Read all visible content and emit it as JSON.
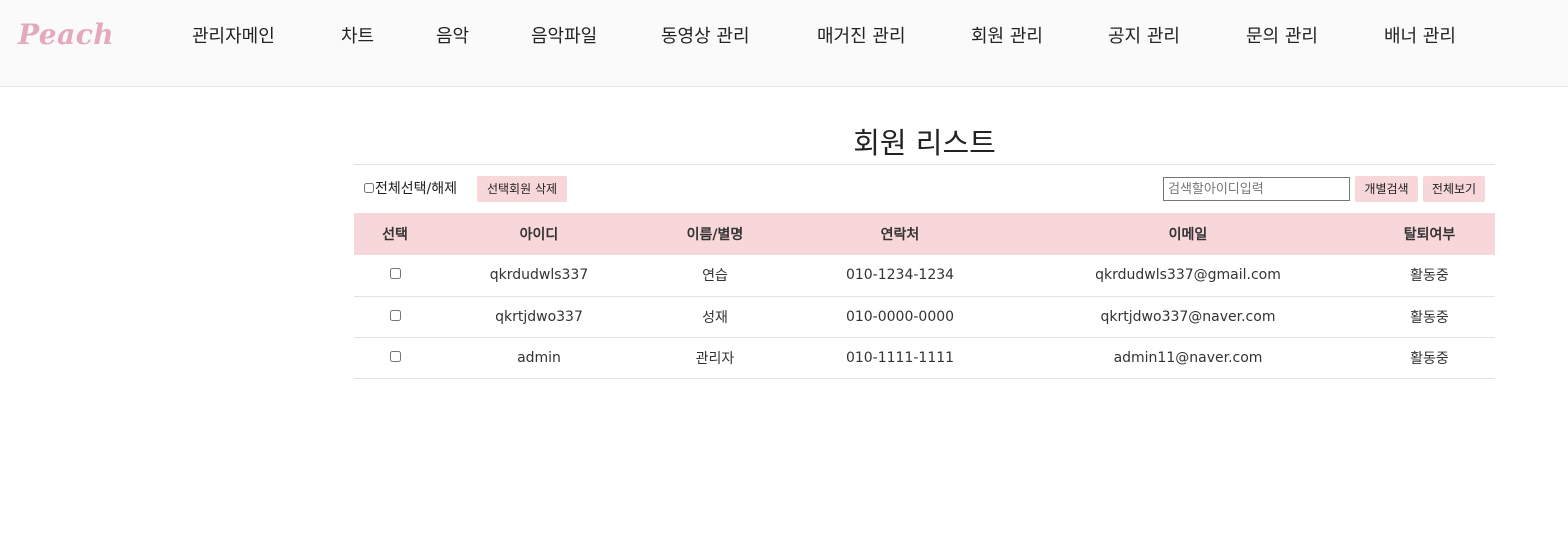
{
  "brand": {
    "logo": "Peach"
  },
  "nav": {
    "items": [
      "관리자메인",
      "차트",
      "음악",
      "음악파일",
      "동영상 관리",
      "매거진 관리",
      "회원 관리",
      "공지 관리",
      "문의 관리",
      "배너 관리"
    ]
  },
  "page": {
    "title": "회원 리스트"
  },
  "toolbar": {
    "select_all_label": "전체선택/해제",
    "delete_selected_label": "선택회원 삭제",
    "search_placeholder": "검색할아이디입력",
    "search_button_label": "개별검색",
    "view_all_label": "전체보기"
  },
  "table": {
    "columns": [
      "선택",
      "아이디",
      "이름/별명",
      "연락처",
      "이메일",
      "탈퇴여부"
    ],
    "rows": [
      {
        "id": "qkrdudwls337",
        "name": "연습",
        "phone": "010-1234-1234",
        "email": "qkrdudwls337@gmail.com",
        "status": "활동중"
      },
      {
        "id": "qkrtjdwo337",
        "name": "성재",
        "phone": "010-0000-0000",
        "email": "qkrtjdwo337@naver.com",
        "status": "활동중"
      },
      {
        "id": "admin",
        "name": "관리자",
        "phone": "010-1111-1111",
        "email": "admin11@naver.com",
        "status": "활동중"
      }
    ]
  },
  "colors": {
    "accent": "#f7d7da",
    "logo": "#e3a9bd",
    "nav_bg": "#fafafa"
  }
}
